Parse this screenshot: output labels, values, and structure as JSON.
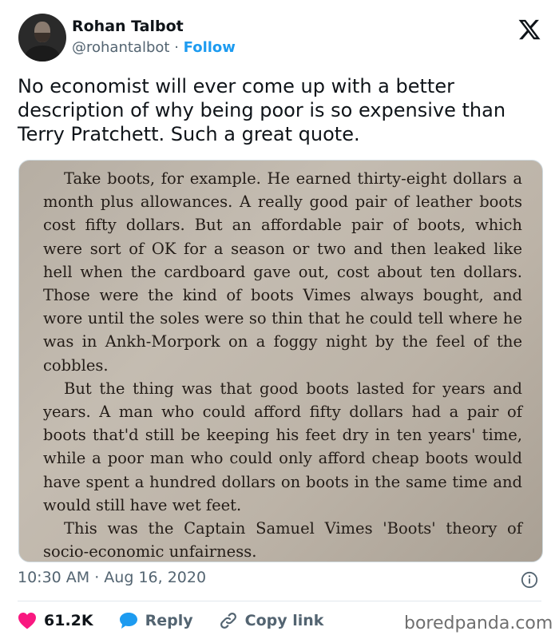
{
  "author": {
    "name": "Rohan Talbot",
    "handle": "@rohantalbot",
    "separator": "·",
    "follow_label": "Follow"
  },
  "tweet": {
    "text": "No economist will ever come up with a better description of why being poor is so expensive than Terry Pratchett. Such a great quote."
  },
  "photo": {
    "paragraphs": [
      "Take boots, for example. He earned thirty-eight dollars a month plus allowances. A really good pair of leather boots cost fifty dollars. But an affordable pair of boots, which were sort of OK for a season or two and then leaked like hell when the cardboard gave out, cost about ten dollars. Those were the kind of boots Vimes always bought, and wore until the soles were so thin that he could tell where he was in Ankh-Morpork on a foggy night by the feel of the cobbles.",
      "But the thing was that good boots lasted for years and years. A man who could afford fifty dollars had a pair of boots that'd still be keeping his feet dry in ten years' time, while a poor man who could only afford cheap boots would have spent a hundred dollars on boots in the same time and would still have wet feet.",
      "This was the Captain Samuel Vimes 'Boots' theory of socio-economic unfairness."
    ]
  },
  "meta": {
    "timestamp": "10:30 AM · Aug 16, 2020"
  },
  "actions": {
    "likes": "61.2K",
    "reply_label": "Reply",
    "copy_link_label": "Copy link"
  },
  "watermark": "boredpanda.com",
  "colors": {
    "accent": "#1d9bf0",
    "like": "#f91880",
    "text": "#0f1419",
    "muted": "#536471"
  },
  "icons": [
    "x-logo-icon",
    "info-icon",
    "heart-icon",
    "reply-bubble-icon",
    "link-icon"
  ]
}
